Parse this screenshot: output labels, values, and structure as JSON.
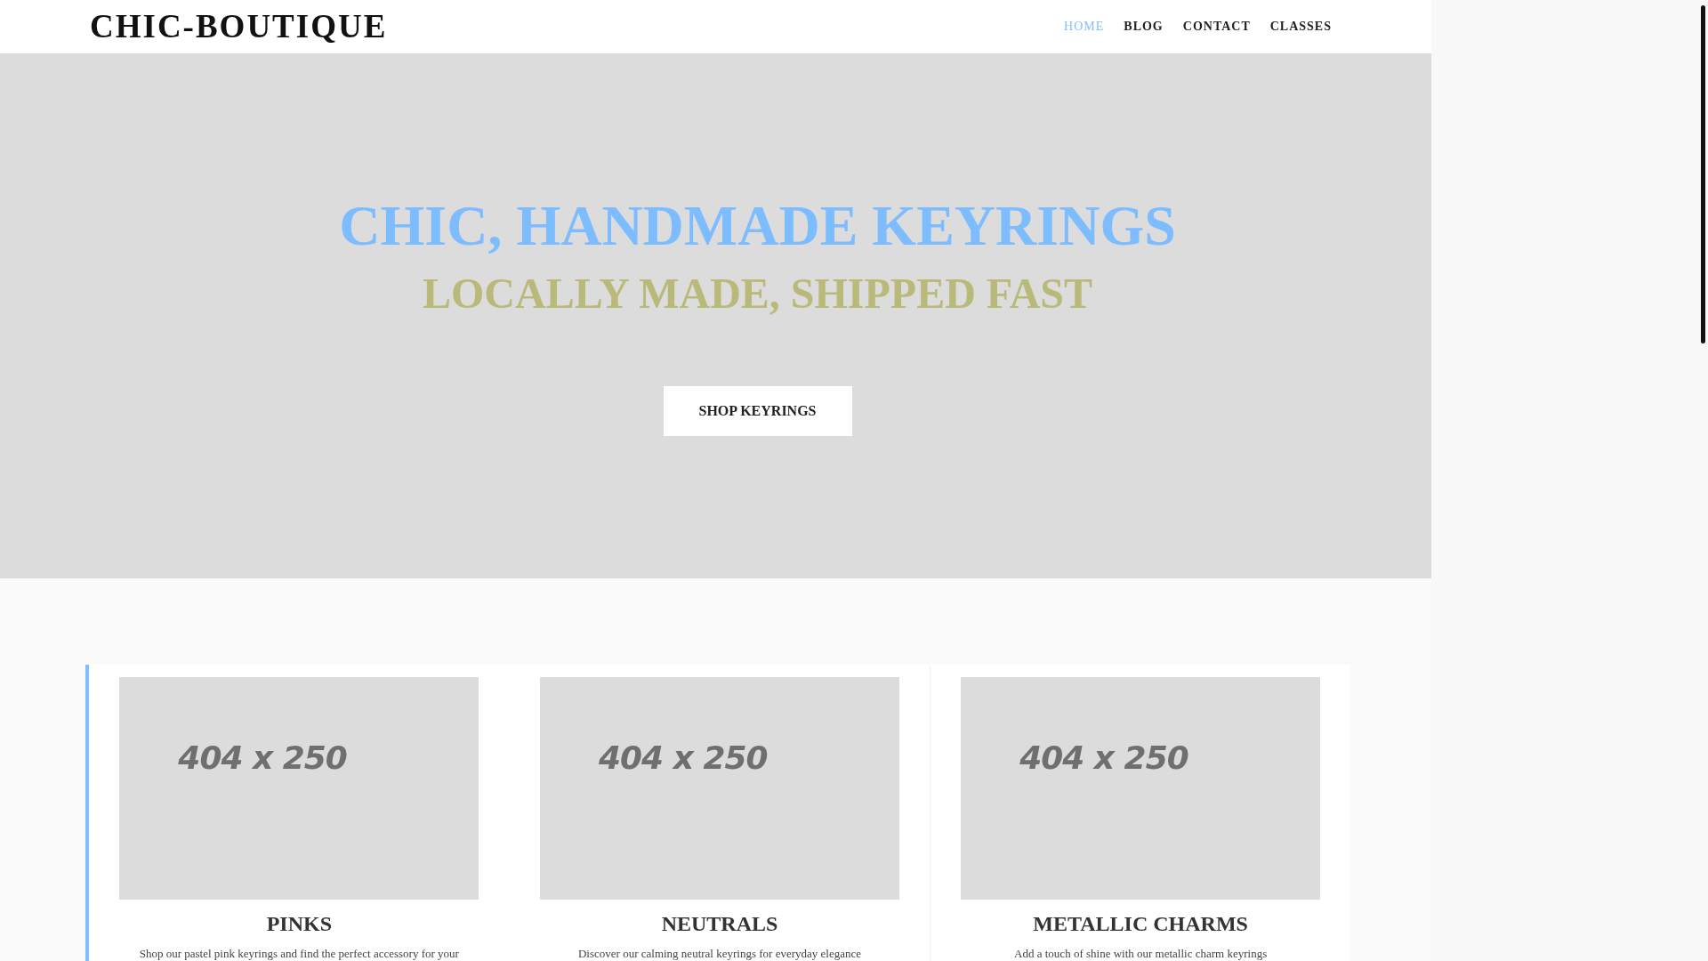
{
  "header": {
    "logo": "CHIC-BOUTIQUE",
    "nav": [
      {
        "label": "HOME",
        "selected": true
      },
      {
        "label": "BLOG",
        "selected": false
      },
      {
        "label": "CONTACT",
        "selected": false
      },
      {
        "label": "CLASSES",
        "selected": false
      }
    ]
  },
  "hero": {
    "title": "CHIC, HANDMADE KEYRINGS",
    "subtitle": "LOCALLY MADE, SHIPPED FAST",
    "button": "SHOP KEYRINGS"
  },
  "cards": [
    {
      "image": "404 x 250",
      "title": "PINKS",
      "text": "Shop our pastel pink keyrings and find the perfect accessory for your"
    },
    {
      "image": "404 x 250",
      "title": "NEUTRALS",
      "text": "Discover our calming neutral keyrings for everyday elegance"
    },
    {
      "image": "404 x 250",
      "title": "METALLIC CHARMS",
      "text": "Add a touch of shine with our metallic charm keyrings"
    }
  ]
}
